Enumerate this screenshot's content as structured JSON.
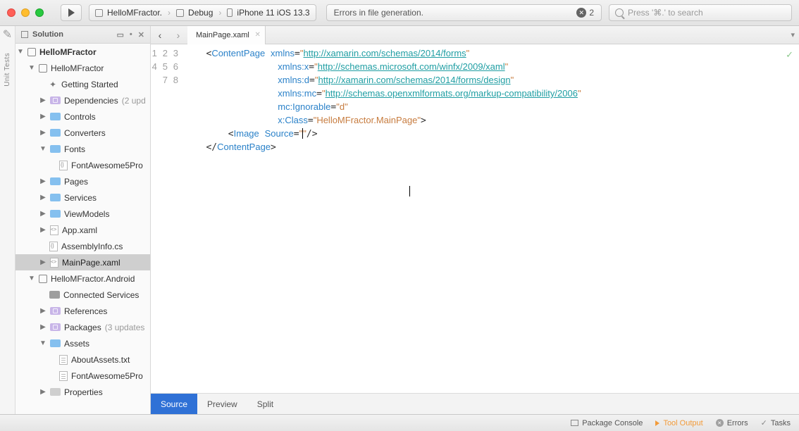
{
  "titlebar": {
    "scheme": {
      "project": "HelloMFractor.",
      "config": "Debug",
      "device": "iPhone 11 iOS 13.3"
    },
    "status": "Errors in file generation.",
    "errorCount": "2",
    "searchPlaceholder": "Press '⌘.' to search"
  },
  "leftDock": {
    "label": "Unit Tests"
  },
  "sidebar": {
    "title": "Solution",
    "nodes": {
      "solution": "HelloMFractor",
      "proj1": "HelloMFractor",
      "gettingStarted": "Getting Started",
      "dependencies": "Dependencies",
      "dependenciesHint": "(2 upd",
      "controls": "Controls",
      "converters": "Converters",
      "fonts": "Fonts",
      "fontAwesome": "FontAwesome5Pro",
      "pages": "Pages",
      "services": "Services",
      "viewModels": "ViewModels",
      "appXaml": "App.xaml",
      "assemblyInfo": "AssemblyInfo.cs",
      "mainPage": "MainPage.xaml",
      "proj2": "HelloMFractor.Android",
      "connectedServices": "Connected Services",
      "references": "References",
      "packages": "Packages",
      "packagesHint": "(3 updates",
      "assets": "Assets",
      "aboutAssets": "AboutAssets.txt",
      "fontAwesome2": "FontAwesome5Pro",
      "properties": "Properties"
    }
  },
  "editor": {
    "tab": "MainPage.xaml",
    "lines": [
      "1",
      "2",
      "3",
      "4",
      "5",
      "6",
      "7",
      "8"
    ],
    "tags": {
      "contentPageOpen": "ContentPage",
      "image": "Image",
      "contentPageClose": "ContentPage"
    },
    "attrs": {
      "xmlns": "xmlns",
      "xmlnsx": "xmlns:x",
      "xmlnsd": "xmlns:d",
      "xmlnsmc": "xmlns:mc",
      "mcIgnorable": "mc:Ignorable",
      "xClass": "x:Class",
      "source": "Source"
    },
    "vals": {
      "xmlns": "http://xamarin.com/schemas/2014/forms",
      "xmlnsx": "http://schemas.microsoft.com/winfx/2009/xaml",
      "xmlnsd": "http://xamarin.com/schemas/2014/forms/design",
      "xmlnsmc": "http://schemas.openxmlformats.org/markup-compatibility/2006",
      "mcIgnorable": "d",
      "xClass": "HelloMFractor.MainPage",
      "source": ""
    },
    "viewTabs": {
      "source": "Source",
      "preview": "Preview",
      "split": "Split"
    }
  },
  "bottom": {
    "packageConsole": "Package Console",
    "toolOutput": "Tool Output",
    "errors": "Errors",
    "tasks": "Tasks"
  }
}
